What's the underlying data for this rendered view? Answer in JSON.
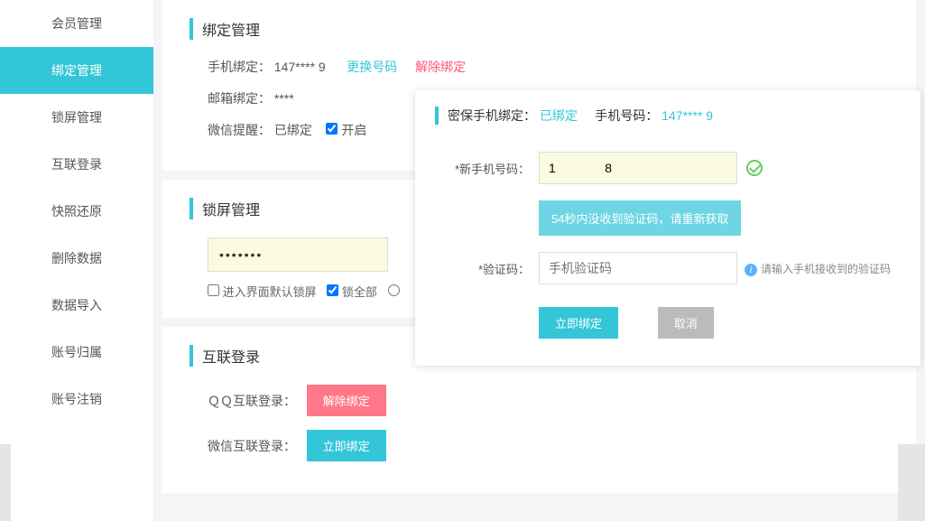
{
  "sidebar": {
    "items": [
      {
        "label": "会员管理"
      },
      {
        "label": "绑定管理"
      },
      {
        "label": "锁屏管理"
      },
      {
        "label": "互联登录"
      },
      {
        "label": "快照还原"
      },
      {
        "label": "删除数据"
      },
      {
        "label": "数据导入"
      },
      {
        "label": "账号归属"
      },
      {
        "label": "账号注销"
      }
    ],
    "active_index": 1
  },
  "binding": {
    "title": "绑定管理",
    "phone_label": "手机绑定：",
    "phone_value": "147****   9",
    "change_label": "更换号码",
    "unbind_label": "解除绑定",
    "email_label": "邮箱绑定：",
    "email_value": "               ****",
    "wechat_label": "微信提醒：",
    "wechat_value": "已绑定",
    "open_label": "开启"
  },
  "lock": {
    "title": "锁屏管理",
    "password_mask": "•••••••",
    "cb1_label": "进入界面默认锁屏",
    "cb2_label": "锁全部"
  },
  "oauth": {
    "title": "互联登录",
    "qq_label": "ＱＱ互联登录：",
    "qq_button": "解除绑定",
    "wechat_label": "微信互联登录：",
    "wechat_button": "立即绑定"
  },
  "popup": {
    "header_label": "密保手机绑定：",
    "header_status": "已绑定",
    "phone_label": "手机号码：",
    "phone_value": "147****     9",
    "new_phone_label": "*新手机号码：",
    "new_phone_value": "1              8",
    "resend_label": "54秒内没收到验证码，请重新获取",
    "code_label": "*验证码：",
    "code_placeholder": "手机验证码",
    "hint": "请输入手机接收到的验证码",
    "submit_label": "立即绑定",
    "cancel_label": "取消"
  }
}
